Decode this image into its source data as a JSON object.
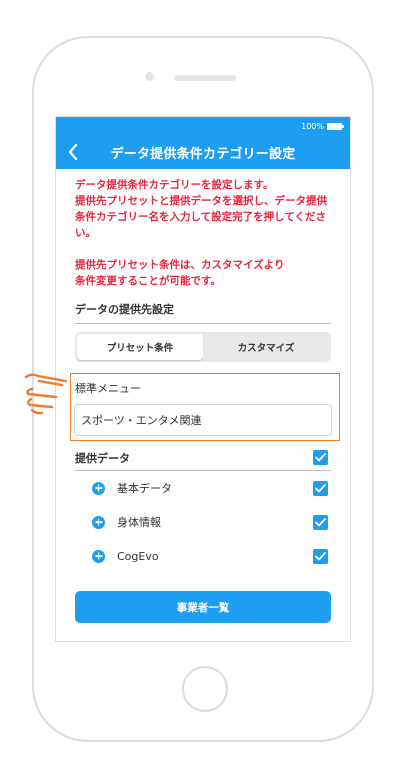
{
  "status_bar": {
    "battery": "100%"
  },
  "nav": {
    "title": "データ提供条件カテゴリー設定"
  },
  "notice": {
    "paragraph1": "データ提供条件カテゴリーを設定します。\n提供先プリセットと提供データを選択し、データ提供条件カテゴリー名を入力して設定完了を押してください。",
    "paragraph2": "提供先プリセット条件は、カスタマイズより\n条件変更することが可能です。"
  },
  "provider_settings": {
    "title": "データの提供先設定",
    "tabs": [
      {
        "label": "プリセット条件",
        "active": true
      },
      {
        "label": "カスタマイズ",
        "active": false
      }
    ]
  },
  "standard_menu": {
    "label": "標準メニュー",
    "selected": "スポーツ・エンタメ関連"
  },
  "provided_data": {
    "header": "提供データ",
    "header_checked": true,
    "items": [
      {
        "label": "基本データ",
        "checked": true
      },
      {
        "label": "身体情報",
        "checked": true
      },
      {
        "label": "CogEvo",
        "checked": true
      }
    ]
  },
  "actions": {
    "operators_button": "事業者一覧"
  },
  "colors": {
    "primary": "#1e9ef0",
    "notice": "#e8263d",
    "highlight": "#f07b2c"
  }
}
